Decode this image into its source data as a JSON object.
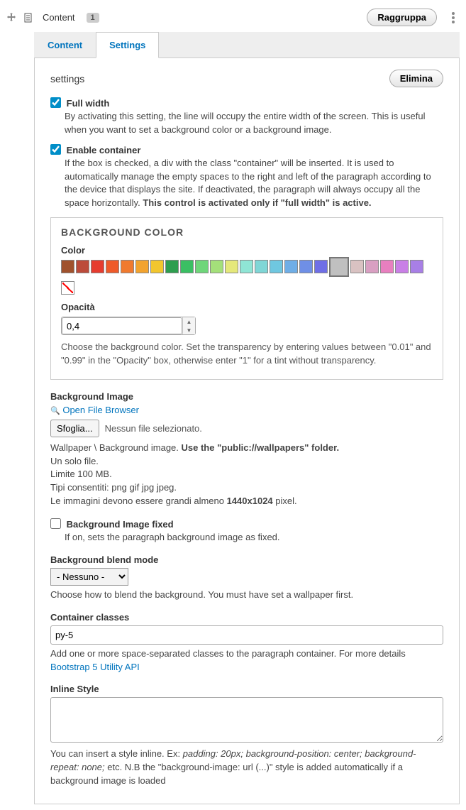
{
  "header": {
    "title": "Content",
    "badge": "1",
    "group_button": "Raggruppa"
  },
  "tabs": {
    "content": "Content",
    "settings": "Settings"
  },
  "panel": {
    "title": "settings",
    "delete_button": "Elimina",
    "full_width": {
      "label": "Full width",
      "desc": "By activating this setting, the line will occupy the entire width of the screen. This is useful when you want to set a background color or a background image."
    },
    "enable_container": {
      "label": "Enable container",
      "desc_a": "If the box is checked, a div with the class \"container\" will be inserted. It is used to automatically manage the empty spaces to the right and left of the paragraph according to the device that displays the site. If deactivated, the paragraph will always occupy all the space horizontally. ",
      "desc_b": "This control is activated only if \"full width\" is active."
    },
    "bg": {
      "title": "BACKGROUND COLOR",
      "color_label": "Color",
      "opacity_label": "Opacità",
      "opacity_value": "0,4",
      "help": "Choose the background color. Set the transparency by entering values between \"0.01\" and \"0.99\" in the \"Opacity\" box, otherwise enter \"1\" for a tint without transparency.",
      "colors": [
        "#a0522d",
        "#bc4b3a",
        "#e63c2f",
        "#ef5a2a",
        "#f07a2f",
        "#f2a32e",
        "#f2c62e",
        "#2e9e4f",
        "#3abf63",
        "#6fd67a",
        "#a4e07a",
        "#e5e87a",
        "#8fe5d5",
        "#7fd6d6",
        "#6fc7e0",
        "#6faee6",
        "#6f8fe6",
        "#6f6fe6"
      ],
      "selected_color": "#c0c0c0",
      "colors2": [
        "#d9c2c2",
        "#d99fc2",
        "#e87fbf",
        "#c97fe6",
        "#a87fe6"
      ]
    },
    "bg_image": {
      "title": "Background Image",
      "open_link": "Open File Browser",
      "choose_btn": "Sfoglia...",
      "no_file": "Nessun file selezionato.",
      "help1a": "Wallpaper \\ Background image. ",
      "help1b": "Use the \"public://wallpapers\" folder.",
      "help2": "Un solo file.",
      "help3": "Limite 100 MB.",
      "help4": "Tipi consentiti: png gif jpg jpeg.",
      "help5a": "Le immagini devono essere grandi almeno ",
      "help5b": "1440x1024",
      "help5c": " pixel."
    },
    "bg_fixed": {
      "label": "Background Image fixed",
      "desc": "If on, sets the paragraph background image as fixed."
    },
    "blend": {
      "title": "Background blend mode",
      "selected": "- Nessuno -",
      "help": "Choose how to blend the background. You must have set a wallpaper first."
    },
    "container_classes": {
      "title": "Container classes",
      "value": "py-5",
      "help_a": "Add one or more space-separated classes to the paragraph container. For more details ",
      "help_link": "Bootstrap 5 Utility API"
    },
    "inline_style": {
      "title": "Inline Style",
      "help_a": "You can insert a style inline. Ex: ",
      "help_ex": "padding: 20px; background-position: center; background-repeat: none;",
      "help_b": " etc. N.B the \"background-image: url (...)\" style is added automatically if a background image is loaded"
    }
  }
}
